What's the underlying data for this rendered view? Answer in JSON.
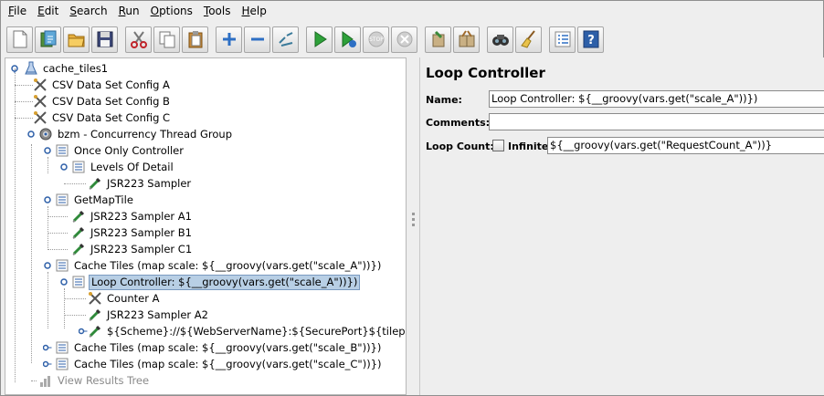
{
  "menu": [
    {
      "mn": "F",
      "rest": "ile"
    },
    {
      "mn": "E",
      "rest": "dit"
    },
    {
      "mn": "S",
      "rest": "earch"
    },
    {
      "mn": "R",
      "rest": "un"
    },
    {
      "mn": "O",
      "rest": "ptions"
    },
    {
      "mn": "T",
      "rest": "ools"
    },
    {
      "mn": "H",
      "rest": "elp"
    }
  ],
  "toolbar_icons": [
    "new-icon",
    "templates-icon",
    "open-icon",
    "save-icon",
    "cut-icon",
    "copy-icon",
    "paste-icon",
    "expand-icon",
    "collapse-icon",
    "toggle-icon",
    "start-icon",
    "start-no-pause-icon",
    "stop-icon",
    "shutdown-icon",
    "clear-icon",
    "clear-all-icon",
    "search-icon",
    "reset-search-icon",
    "function-helper-icon",
    "help-icon"
  ],
  "tree": {
    "root": "cache_tiles1",
    "csv_a": "CSV Data Set Config A",
    "csv_b": "CSV Data Set Config B",
    "csv_c": "CSV Data Set Config C",
    "thread_group": "bzm - Concurrency Thread Group",
    "once_only": "Once Only Controller",
    "levels_of_detail": "Levels Of Detail",
    "jsr223_sampler": "JSR223 Sampler",
    "get_map_tile": "GetMapTile",
    "jsr_a1": "JSR223 Sampler A1",
    "jsr_b1": "JSR223 Sampler B1",
    "jsr_c1": "JSR223 Sampler C1",
    "cache_tiles_a": "Cache Tiles (map scale: ${__groovy(vars.get(\"scale_A\"))})",
    "loop_controller": "Loop Controller: ${__groovy(vars.get(\"scale_A\"))})",
    "counter_a": "Counter A",
    "jsr_a2": "JSR223 Sampler A2",
    "http_sampler": "${Scheme}://${WebServerName}:${SecurePort}${tilepath_A}",
    "cache_tiles_b": "Cache Tiles (map scale: ${__groovy(vars.get(\"scale_B\"))})",
    "cache_tiles_c": "Cache Tiles (map scale: ${__groovy(vars.get(\"scale_C\"))})",
    "view_results_tree": "View Results Tree"
  },
  "panel": {
    "title": "Loop Controller",
    "name_label": "Name:",
    "name_value": "Loop Controller: ${__groovy(vars.get(\"scale_A\"))})",
    "comments_label": "Comments:",
    "comments_value": "",
    "loop_count_label": "Loop Count:",
    "infinite_label": "Infinite",
    "infinite_checked": false,
    "loop_count_value": "${__groovy(vars.get(\"RequestCount_A\"))}"
  },
  "colors": {
    "selection": "#b8cfe5",
    "background": "#eeeeee",
    "disabled_text": "#8a8a8a"
  }
}
